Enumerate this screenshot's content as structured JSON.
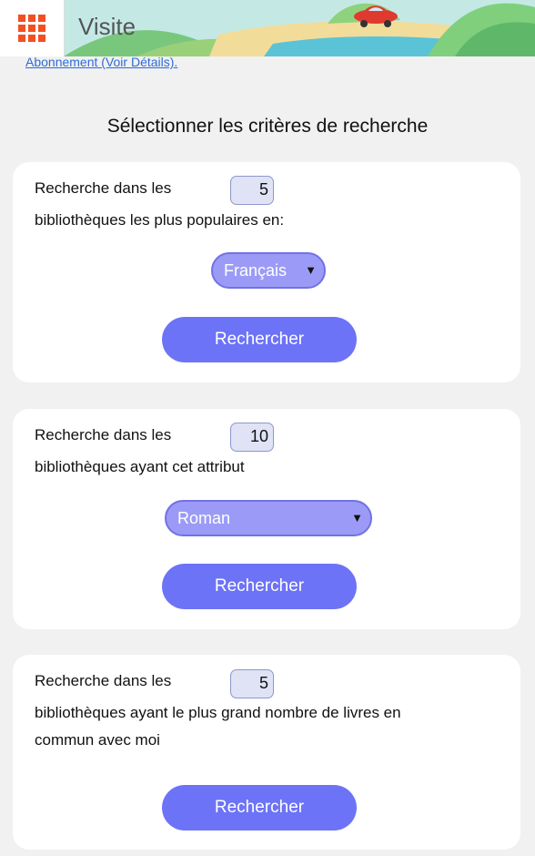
{
  "header": {
    "title": "Visite",
    "menu_icon": "grid-icon",
    "accent_color": "#f25022"
  },
  "subscription_link": "Abonnement (Voir Détails).",
  "section_title": "Sélectionner les critères de recherche",
  "cards": [
    {
      "line1": "Recherche dans les",
      "line2": "bibliothèques les plus populaires en:",
      "count": "5",
      "select_value": "Français",
      "button_label": "Rechercher"
    },
    {
      "line1": "Recherche dans les",
      "line2": "bibliothèques ayant cet attribut",
      "count": "10",
      "select_value": "Roman",
      "button_label": "Rechercher"
    },
    {
      "line1": "Recherche dans les",
      "line2": "bibliothèques ayant le plus grand nombre de livres en",
      "line3": "commun avec moi",
      "count": "5",
      "button_label": "Rechercher"
    }
  ],
  "colors": {
    "button": "#6d73f6",
    "select": "#9b9bf7",
    "page_bg": "#f1f1f1"
  }
}
